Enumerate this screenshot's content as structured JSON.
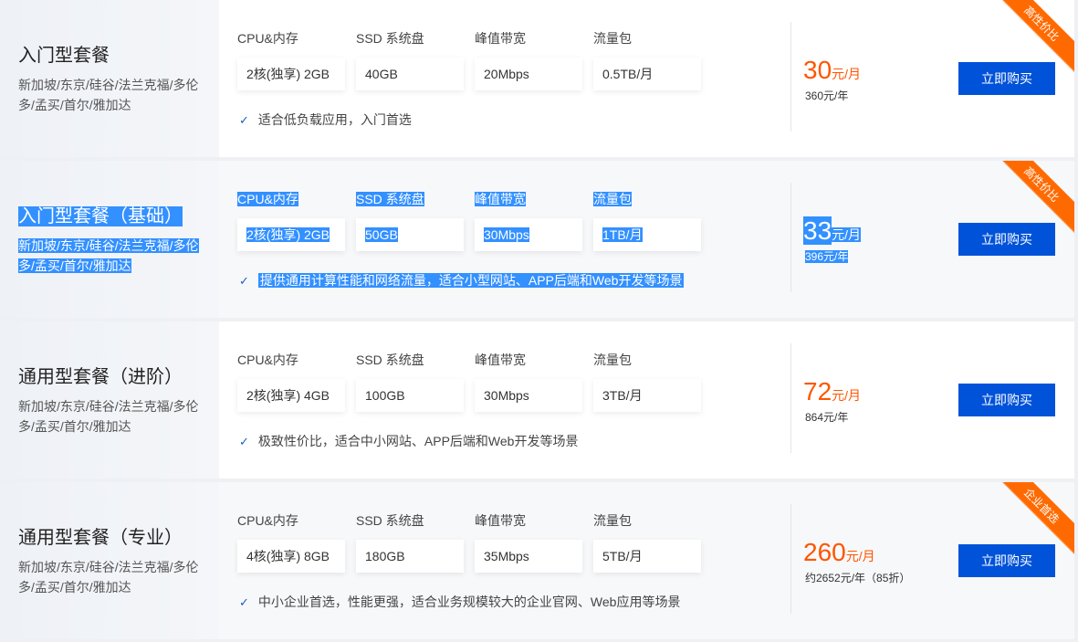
{
  "spec_labels": [
    "CPU&内存",
    "SSD 系统盘",
    "峰值带宽",
    "流量包"
  ],
  "buy_label": "立即购买",
  "colors": {
    "accent": "#0052d9",
    "price": "#ff5500",
    "ribbon": "#ff6a00",
    "selection": "#3390ff"
  },
  "plans": [
    {
      "title": "入门型套餐",
      "regions": "新加坡/东京/硅谷/法兰克福/多伦多/孟买/首尔/雅加达",
      "specs": [
        "2核(独享) 2GB",
        "40GB",
        "20Mbps",
        "0.5TB/月"
      ],
      "desc": "适合低负载应用，入门首选",
      "price": "30",
      "unit": "元/月",
      "yearly": "360元/年",
      "badge": "高性价比"
    },
    {
      "title": "入门型套餐（基础）",
      "regions": "新加坡/东京/硅谷/法兰克福/多伦多/孟买/首尔/雅加达",
      "specs": [
        "2核(独享) 2GB",
        "50GB",
        "30Mbps",
        "1TB/月"
      ],
      "desc": "提供通用计算性能和网络流量，适合小型网站、APP后端和Web开发等场景",
      "price": "33",
      "unit": "元/月",
      "yearly": "396元/年",
      "badge": "高性价比"
    },
    {
      "title": "通用型套餐（进阶）",
      "regions": "新加坡/东京/硅谷/法兰克福/多伦多/孟买/首尔/雅加达",
      "specs": [
        "2核(独享) 4GB",
        "100GB",
        "30Mbps",
        "3TB/月"
      ],
      "desc": "极致性价比，适合中小网站、APP后端和Web开发等场景",
      "price": "72",
      "unit": "元/月",
      "yearly": "864元/年",
      "badge": ""
    },
    {
      "title": "通用型套餐（专业）",
      "regions": "新加坡/东京/硅谷/法兰克福/多伦多/孟买/首尔/雅加达",
      "specs": [
        "4核(独享) 8GB",
        "180GB",
        "35Mbps",
        "5TB/月"
      ],
      "desc": "中小企业首选，性能更强，适合业务规模较大的企业官网、Web应用等场景",
      "price": "260",
      "unit": "元/月",
      "yearly": "约2652元/年（85折）",
      "badge": "企业首选"
    }
  ]
}
